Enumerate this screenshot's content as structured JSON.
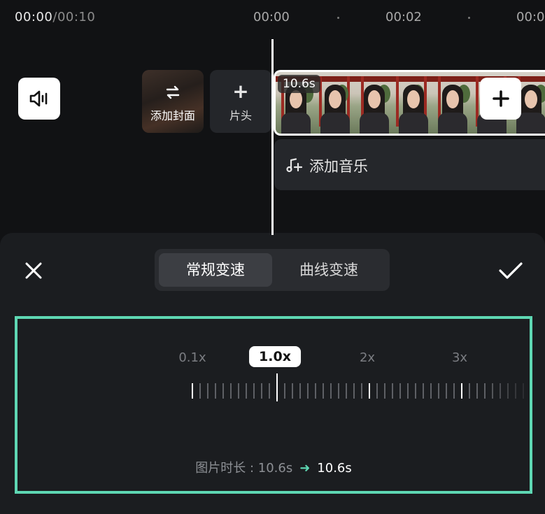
{
  "playback": {
    "current": "00:00",
    "separator": "/",
    "total": "00:10"
  },
  "ruler": {
    "labels": [
      "00:00",
      "00:02",
      "00:0"
    ]
  },
  "timeline": {
    "cover_label": "添加封面",
    "intro_label": "片头",
    "clip_duration": "10.6s",
    "music_label": "添加音乐"
  },
  "speed_panel": {
    "tabs": [
      {
        "label": "常规变速",
        "active": true
      },
      {
        "label": "曲线变速",
        "active": false
      }
    ],
    "marks": [
      "0.1x",
      "2x",
      "3x"
    ],
    "current_speed": "1.0x",
    "duration_label": "图片时长 : 10.6s",
    "duration_arrow": "➜",
    "duration_new": "10.6s"
  },
  "colors": {
    "accent": "#5ed7b3",
    "background": "#111214",
    "panel": "#1b1d20"
  },
  "icons": {
    "volume": "speaker-icon",
    "cover": "swap-icon",
    "add": "plus-icon",
    "music": "music-note-icon",
    "close": "close-icon",
    "confirm": "checkmark-icon",
    "arrow": "arrow-right-icon"
  }
}
